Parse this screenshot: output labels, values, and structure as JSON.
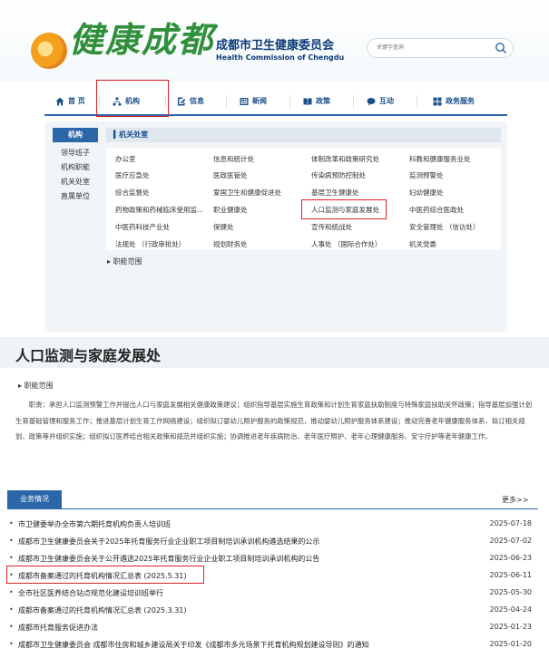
{
  "header": {
    "logo_text": "健康成都",
    "dept_cn": "成都市卫生健康委员会",
    "dept_en": "Health Commission of Chengdu",
    "search_placeholder": "关键字查询"
  },
  "nav": [
    {
      "label": "首 页",
      "icon": "home-icon"
    },
    {
      "label": "机构",
      "icon": "org-chart-icon"
    },
    {
      "label": "信息",
      "icon": "document-edit-icon"
    },
    {
      "label": "新闻",
      "icon": "newspaper-icon"
    },
    {
      "label": "政策",
      "icon": "book-icon"
    },
    {
      "label": "互动",
      "icon": "chat-bubble-icon"
    },
    {
      "label": "政务服务",
      "icon": "grid-icon"
    }
  ],
  "sidebar": {
    "title": "机构",
    "items": [
      "领导班子",
      "机构职能",
      "机关处室",
      "直属单位"
    ]
  },
  "org": {
    "header": "机关处室",
    "rows": [
      [
        "办公室",
        "信息和统计处",
        "体制改革和政策研究处",
        "科教和健康服务业处"
      ],
      [
        "医疗应急处",
        "医政医管处",
        "传染病预防控制处",
        "监测预警处"
      ],
      [
        "综合监督处",
        "爱国卫生和健康促进处",
        "基层卫生健康处",
        "妇幼健康处"
      ],
      [
        "药物政策和药械临床使用监...",
        "职业健康处",
        "人口监测与家庭发展处",
        "中医药综合医政处"
      ],
      [
        "中医药科技产业处",
        "保健处",
        "宣传和统战处",
        "安全管理处 （信访处）"
      ],
      [
        "法规处 （行政审批处）",
        "规划财务处",
        "人事处 （国际合作处）",
        "机关党委"
      ]
    ],
    "duty_link": "职能范围"
  },
  "dept": {
    "title": "人口监测与家庭发展处",
    "duty_header": "职能范围",
    "duty_text": "职责：承担人口监测预警工作并提出人口与家庭发展相关健康政策建议；组织指导基层实施生育政策和计划生育家庭扶助制度与特殊家庭扶助关怀政策；指导基层加强计划生育基础管理和服务工作；推进基层计划生育工作网络建设；组织拟订婴幼儿照护服务的政策规范，推动婴幼儿照护服务体系建设；推动完善老年健康服务体系，拟订相关规划、政策等并组织实施；组织拟订医养结合相关政策和规范并组织实施；协调推进老年疾病防治、老年医疗照护、老年心理健康服务、安宁疗护等老年健康工作。"
  },
  "news": {
    "tab": "业务情况",
    "more": "更多>>",
    "items": [
      {
        "title": "市卫健委举办全市第六期托育机构负责人培训班",
        "date": "2025-07-18"
      },
      {
        "title": "成都市卫生健康委员会关于2025年托育服务行业企业职工项目制培训承训机构遴选结果的公示",
        "date": "2025-07-02"
      },
      {
        "title": "成都市卫生健康委员会关于公开遴选2025年托育服务行业企业职工项目制培训承训机构的公告",
        "date": "2025-06-23"
      },
      {
        "title": "成都市备案通过的托育机构情况汇总表 (2025.5.31)",
        "date": "2025-06-11"
      },
      {
        "title": "全市社区医养结合站点规范化建设培训班举行",
        "date": "2025-05-30"
      },
      {
        "title": "成都市备案通过的托育机构情况汇总表 (2025.3.31)",
        "date": "2025-04-24"
      },
      {
        "title": "成都市托育服务促进办法",
        "date": "2025-01-23"
      },
      {
        "title": "成都市卫生健康委员会 成都市住房和城乡建设局关于印发《成都市多元场景下托育机构规划建设导则》的通知",
        "date": "2025-01-20"
      }
    ]
  },
  "colors": {
    "brand_blue": "#2a66a8",
    "brand_green": "#2f8f3a",
    "highlight_red": "#e02020"
  }
}
